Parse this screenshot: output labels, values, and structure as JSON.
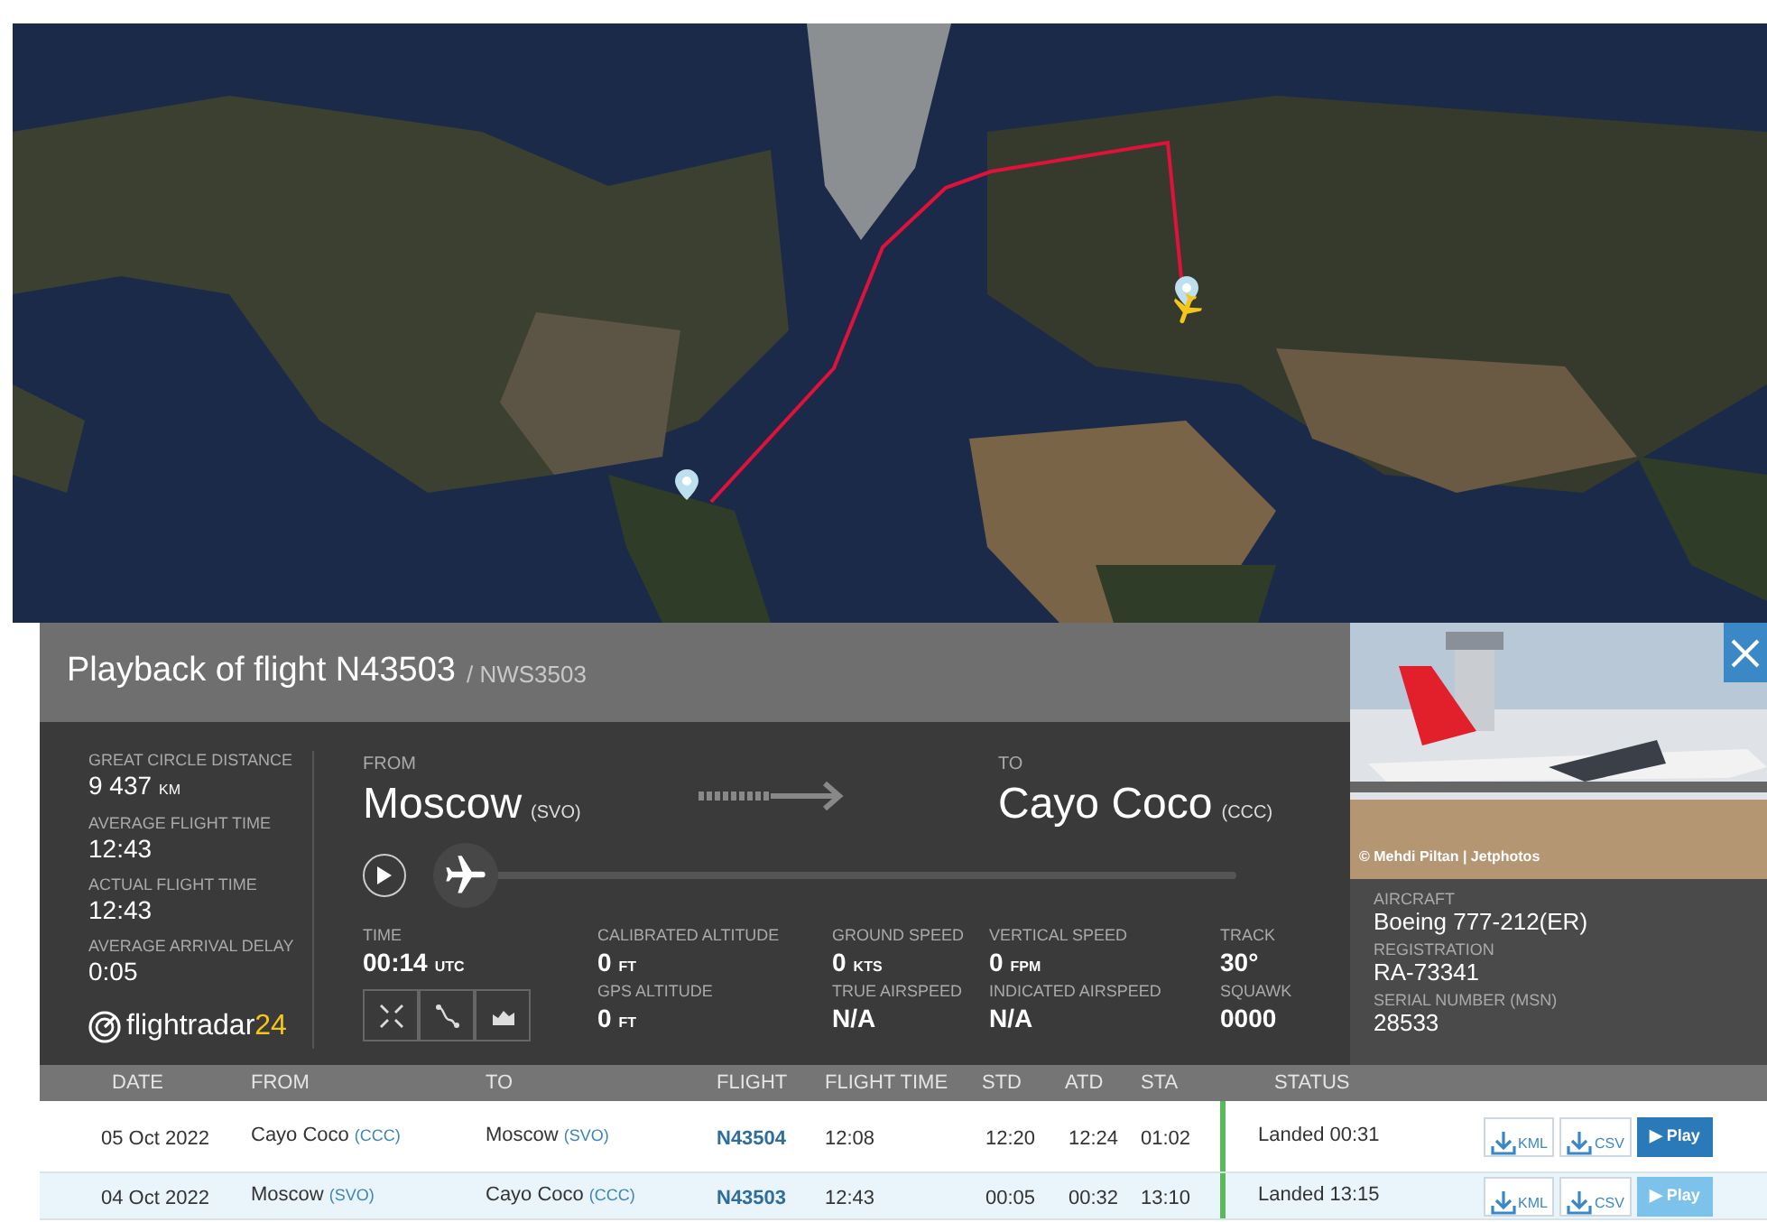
{
  "panel": {
    "title": "Playback of flight N43503",
    "callsign": "/ NWS3503"
  },
  "stats": [
    {
      "label": "GREAT CIRCLE DISTANCE",
      "value": "9 437",
      "unit": "KM"
    },
    {
      "label": "AVERAGE FLIGHT TIME",
      "value": "12:43"
    },
    {
      "label": "ACTUAL FLIGHT TIME",
      "value": "12:43"
    },
    {
      "label": "AVERAGE ARRIVAL DELAY",
      "value": "0:05"
    }
  ],
  "logo": {
    "name": "flightradar",
    "suffix": "24"
  },
  "from": {
    "label": "FROM",
    "city": "Moscow",
    "code": "(SVO)"
  },
  "to": {
    "label": "TO",
    "city": "Cayo Coco",
    "code": "(CCC)"
  },
  "playback": {
    "level": 0
  },
  "readings": [
    [
      {
        "label": "TIME",
        "value": "00:14",
        "unit": "UTC"
      }
    ],
    [
      {
        "label": "CALIBRATED ALTITUDE",
        "value": "0",
        "unit": "FT"
      },
      {
        "label": "GPS ALTITUDE",
        "value": "0",
        "unit": "FT"
      }
    ],
    [
      {
        "label": "GROUND SPEED",
        "value": "0",
        "unit": "KTS"
      },
      {
        "label": "TRUE AIRSPEED",
        "value": "N/A"
      }
    ],
    [
      {
        "label": "VERTICAL SPEED",
        "value": "0",
        "unit": "FPM"
      },
      {
        "label": "INDICATED AIRSPEED",
        "value": "N/A"
      }
    ],
    [
      {
        "label": "TRACK",
        "value": "30°"
      },
      {
        "label": "SQUAWK",
        "value": "0000"
      }
    ]
  ],
  "aircraft": {
    "photo_credit": "© Mehdi Piltan | Jetphotos",
    "fields": [
      {
        "label": "AIRCRAFT",
        "value": "Boeing 777-212(ER)"
      },
      {
        "label": "REGISTRATION",
        "value": "RA-73341"
      },
      {
        "label": "SERIAL NUMBER (MSN)",
        "value": "28533"
      }
    ]
  },
  "table": {
    "columns": [
      "DATE",
      "FROM",
      "TO",
      "FLIGHT",
      "FLIGHT TIME",
      "STD",
      "ATD",
      "STA",
      "STATUS"
    ],
    "rows": [
      {
        "selected": false,
        "date": "05 Oct 2022",
        "from": {
          "city": "Cayo Coco",
          "code": "(CCC)"
        },
        "to": {
          "city": "Moscow",
          "code": "(SVO)"
        },
        "flight": "N43504",
        "flight_time": "12:08",
        "std": "12:20",
        "atd": "12:24",
        "sta": "01:02",
        "status": "Landed 00:31",
        "color": "#5cb85c",
        "buttons": [
          "KML",
          "CSV",
          "▶ Play"
        ]
      },
      {
        "selected": true,
        "date": "04 Oct 2022",
        "from": {
          "city": "Moscow",
          "code": "(SVO)"
        },
        "to": {
          "city": "Cayo Coco",
          "code": "(CCC)"
        },
        "flight": "N43503",
        "flight_time": "12:43",
        "std": "00:05",
        "atd": "00:32",
        "sta": "13:10",
        "status": "Landed 13:15",
        "color": "#5cb85c",
        "buttons": [
          "KML",
          "CSV",
          "▶ Play"
        ]
      }
    ]
  }
}
